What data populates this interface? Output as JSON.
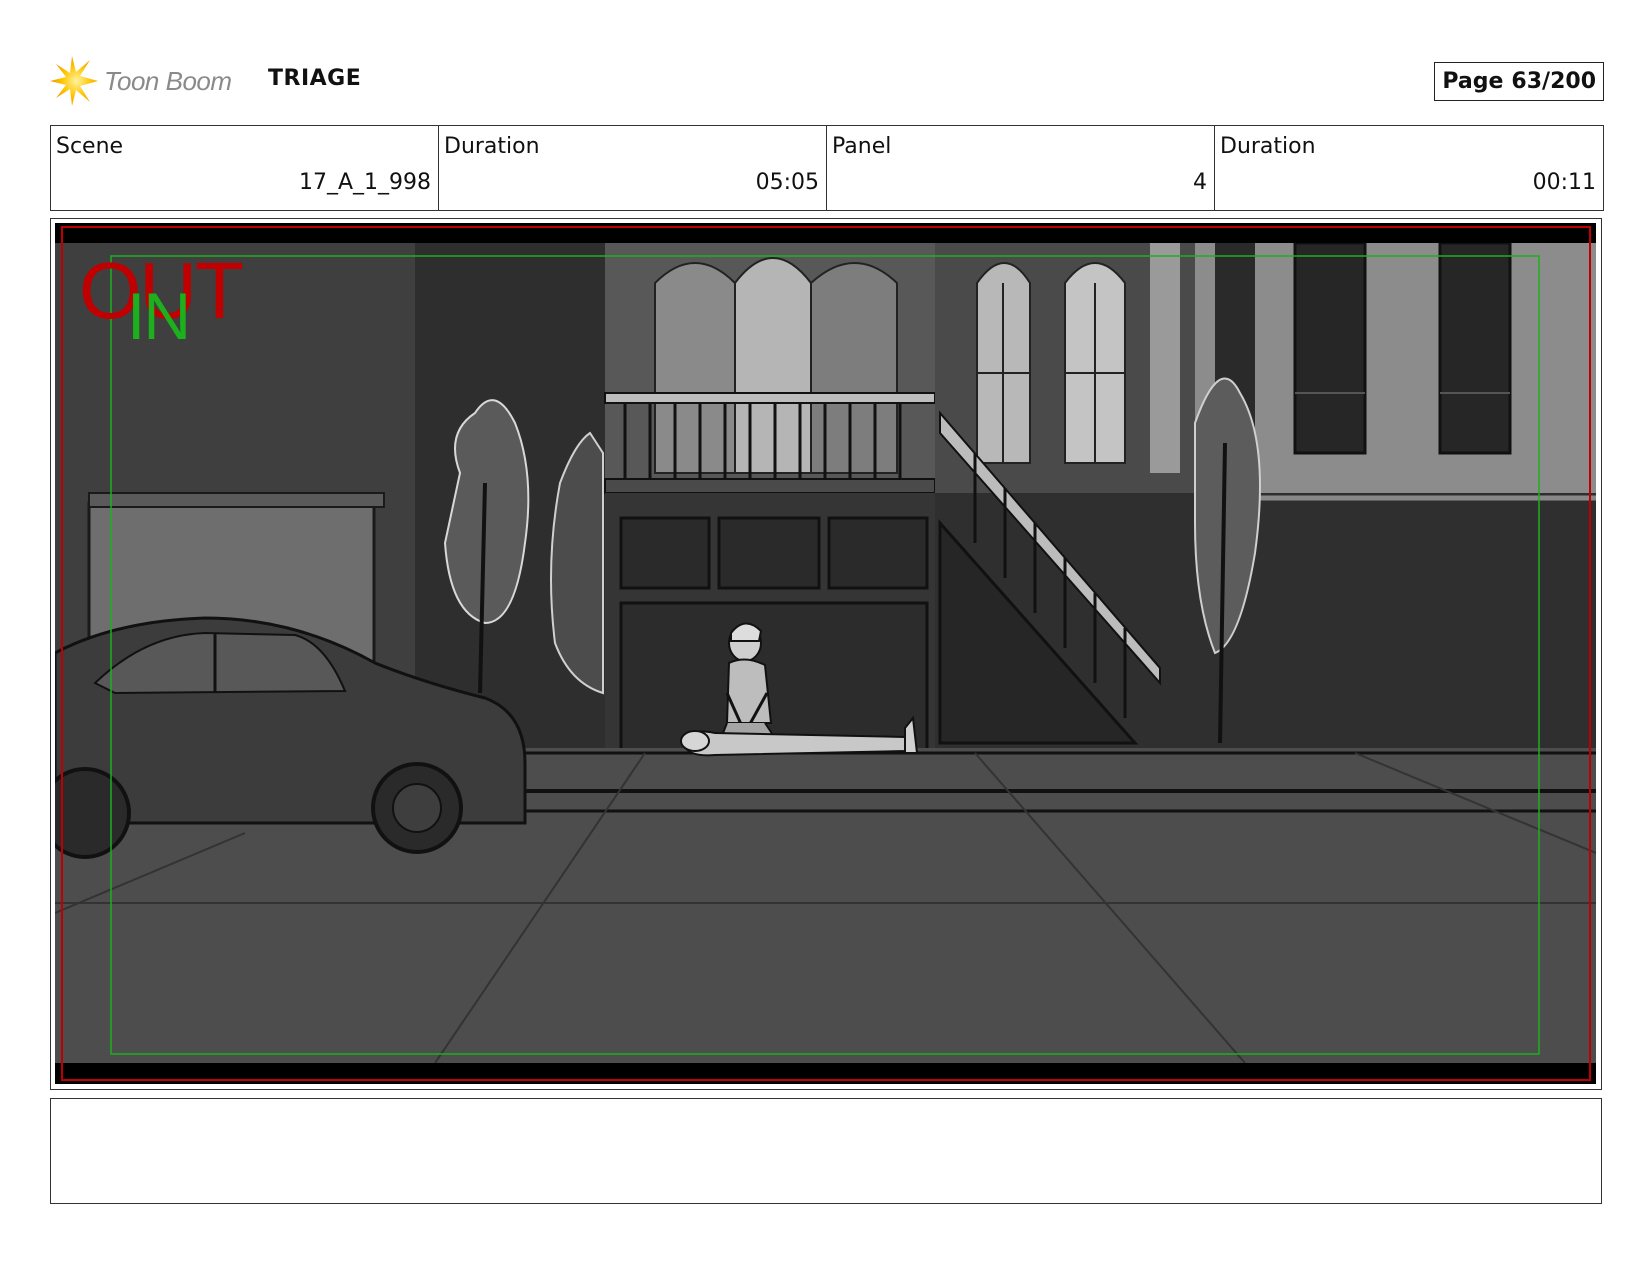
{
  "header": {
    "brand": "Toon Boom",
    "brand_icon": "toon-boom-star-icon",
    "project": "TRIAGE",
    "page_label": "Page",
    "page_value": "63/200"
  },
  "info": {
    "scene_label": "Scene",
    "scene_value": "17_A_1_998",
    "scene_duration_label": "Duration",
    "scene_duration_value": "05:05",
    "panel_label": "Panel",
    "panel_value": "4",
    "panel_duration_label": "Duration",
    "panel_duration_value": "00:11"
  },
  "panel": {
    "out_label": "OUT",
    "in_label": "IN",
    "colors": {
      "out_frame": "#c00000",
      "in_frame": "#1db01d"
    }
  },
  "notes": {
    "text": ""
  }
}
